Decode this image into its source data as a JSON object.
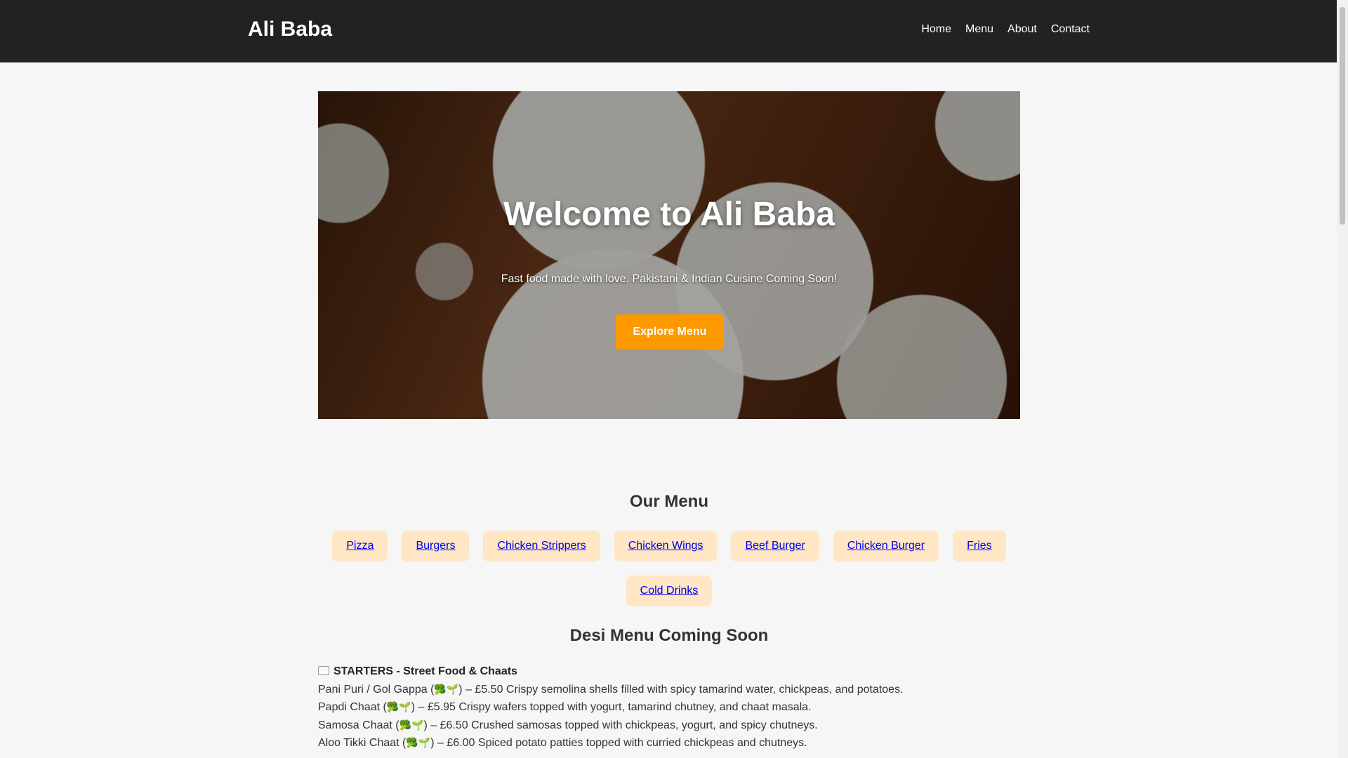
{
  "navbar": {
    "brand": "Ali Baba",
    "links": [
      "Home",
      "Menu",
      "About",
      "Contact"
    ]
  },
  "hero": {
    "title": "Welcome to Ali Baba",
    "tagline": "Fast food made with love. Pakistani & Indian Cuisine Coming Soon!",
    "button_label": "Explore Menu"
  },
  "menu": {
    "title": "Our Menu",
    "tabs": [
      "Pizza",
      "Burgers",
      "Chicken Strippers",
      "Chicken Wings",
      "Beef Burger",
      "Chicken Burger",
      "Fries",
      "Cold Drinks"
    ]
  },
  "desi": {
    "title": "Desi Menu Coming Soon",
    "starters_heading": "STARTERS - Street Food & Chaats",
    "veg_icons": "🥦🌱",
    "items": [
      {
        "name": "Pani Puri / Gol Gappa",
        "price": "£5.50",
        "desc": "Crispy semolina shells filled with spicy tamarind water, chickpeas, and potatoes."
      },
      {
        "name": "Papdi Chaat",
        "price": "£5.95",
        "desc": "Crispy wafers topped with yogurt, tamarind chutney, and chaat masala."
      },
      {
        "name": "Samosa Chaat",
        "price": "£6.50",
        "desc": "Crushed samosas topped with chickpeas, yogurt, and spicy chutneys."
      },
      {
        "name": "Aloo Tikki Chaat",
        "price": "£6.00",
        "desc": "Spiced potato patties topped with curried chickpeas and chutneys."
      }
    ]
  },
  "colors": {
    "navbar_bg": "#222222",
    "accent": "#ff9900",
    "tab_bg": "#ffe6c4",
    "link": "#0000ee"
  }
}
